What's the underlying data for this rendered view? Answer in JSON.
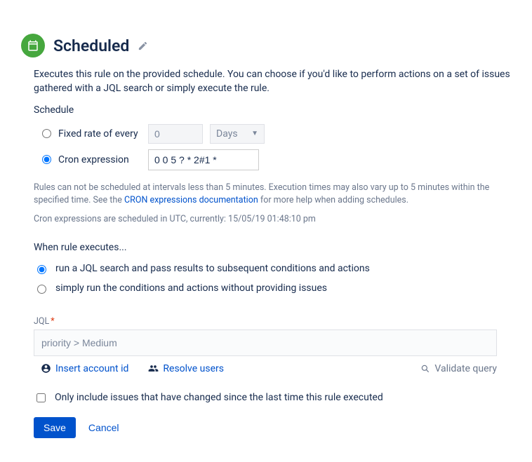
{
  "header": {
    "title": "Scheduled"
  },
  "description": "Executes this rule on the provided schedule. You can choose if you'd like to perform actions on a set of issues gathered with a JQL search or simply execute the rule.",
  "schedule": {
    "label": "Schedule",
    "fixed": {
      "label": "Fixed rate of every",
      "value": "0",
      "unit": "Days"
    },
    "cron": {
      "label": "Cron expression",
      "value": "0 0 5 ? * 2#1 *"
    }
  },
  "help": {
    "pre": "Rules can not be scheduled at intervals less than 5 minutes. Execution times may also vary up to 5 minutes within the specified time. See the ",
    "link": "CRON expressions documentation",
    "post": " for more help when adding schedules.",
    "utc": "Cron expressions are scheduled in UTC, currently: 15/05/19 01:48:10 pm"
  },
  "execute": {
    "label": "When rule executes...",
    "opt1": "run a JQL search and pass results to subsequent conditions and actions",
    "opt2": "simply run the conditions and actions without providing issues"
  },
  "jql": {
    "label": "JQL",
    "placeholder": "priority > Medium",
    "insert_account": "Insert account id",
    "resolve_users": "Resolve users",
    "validate": "Validate query"
  },
  "only_changed": "Only include issues that have changed since the last time this rule executed",
  "buttons": {
    "save": "Save",
    "cancel": "Cancel"
  }
}
